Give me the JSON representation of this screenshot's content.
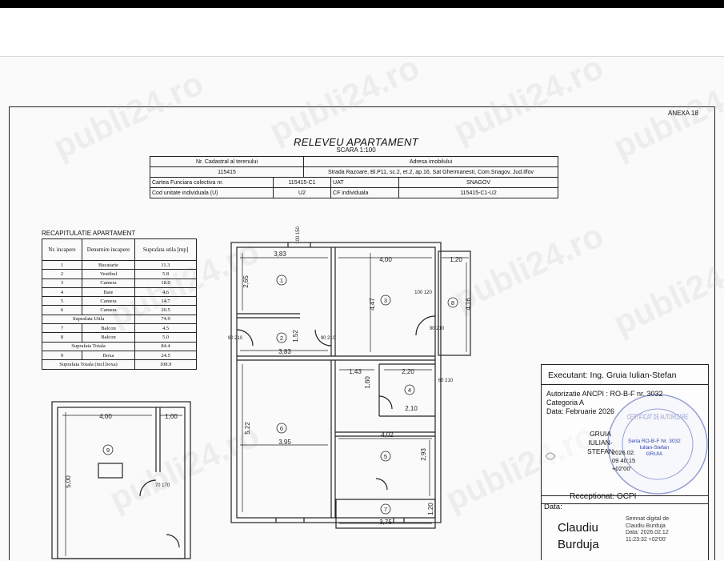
{
  "header": {
    "anexa": "ANEXA 18",
    "title": "RELEVEU APARTAMENT",
    "scale": "SCARA 1:100"
  },
  "cadastral_table": {
    "row1": [
      "Nr. Cadastral al terenului",
      "Adresa imobilului"
    ],
    "row2": [
      "115415",
      "Strada Razoare, Bl.P11, sc.2, et.2, ap.16, Sat Ghermanesti, Com.Snagov, Jud.Ilfov"
    ],
    "row3": [
      "Cartea Funciara colectiva nr.",
      "115415-C1",
      "UAT",
      "SNAGOV"
    ],
    "row4": [
      "Cod unitate individuala (U)",
      "U2",
      "CF individuala",
      "115415-C1-U2"
    ]
  },
  "recap": {
    "title": "RECAPITULATIE APARTAMENT",
    "headers": [
      "Nr. incapere",
      "Denumire incapere",
      "Suprafata utila [mp]"
    ],
    "rows": [
      [
        "1",
        "Bucatarie",
        "11.3"
      ],
      [
        "2",
        "Vestibul",
        "5.8"
      ],
      [
        "3",
        "Camera",
        "18.0"
      ],
      [
        "4",
        "Baie",
        "4.6"
      ],
      [
        "5",
        "Camera",
        "14.7"
      ],
      [
        "6",
        "Camera",
        "20.5"
      ]
    ],
    "sub1_label": "Suprafata Utila",
    "sub1_value": "74.9",
    "rows2": [
      [
        "7",
        "Balcon",
        "4.5"
      ],
      [
        "8",
        "Balcon",
        "5.0"
      ]
    ],
    "sub2_label": "Suprafata Totala",
    "sub2_value": "84.4",
    "rows3": [
      [
        "9",
        "Boxa",
        "24.5"
      ]
    ],
    "sub3_label": "Suprafata Totala (incl.boxa)",
    "sub3_value": "108.9"
  },
  "plan_labels": {
    "room_numbers": [
      "1",
      "2",
      "3",
      "4",
      "5",
      "6",
      "7",
      "8",
      "9"
    ],
    "dims": {
      "d_383_top": "3,83",
      "d_400_top": "4,00",
      "d_120_top": "1,20",
      "d_265": "2,65",
      "d_447": "4,47",
      "d_416": "4,16",
      "d_152": "1,52",
      "d_383_mid": "3,83",
      "d_143": "1,43",
      "d_220": "2,20",
      "d_160": "1,60",
      "d_210": "2,10",
      "d_522": "5,22",
      "d_395": "3,95",
      "d_402": "4,02",
      "d_293": "2,93",
      "d_120_bot": "1,20",
      "d_375": "3,75",
      "box_400": "4,00",
      "box_100": "1,00",
      "box_500": "5,00"
    },
    "openings": {
      "win_top": "100\n150",
      "win_3": "100\n120",
      "door_90_210": "90\n210",
      "door_60": "60\n210",
      "door_box": "70\n170"
    }
  },
  "stamp": {
    "executant": "Executant: Ing. Gruia Iulian-Stefan",
    "autorizatie": "Autorizatie ANCPI : RO-B-F nr. 3032",
    "categoria": "Categoria A",
    "data_feb": "Data: Februarie 2026",
    "gruia_name": "GRUIA\nIULIAN-\nSTEFAN",
    "gruia_sig": "2026.02.\n09 40:15\n+02'00'",
    "seal": "CERTIFICAT DE AUTORIZARE",
    "seal_small": "Seria RO-B-F Nr. 3032\nIulian-Stefan\nGRUIA",
    "receptionat": "Receptionat: OCPI",
    "data_label": "Data:",
    "claudiu": "Claudiu\nBurduja",
    "semnat": "Semnat digital de\nClaudiu Burduja\nData: 2026.02.12\n11:23:32 +02'00'"
  },
  "watermark": "publi24.ro",
  "colors": {
    "line": "#222222",
    "seal": "#2a3fa8"
  }
}
